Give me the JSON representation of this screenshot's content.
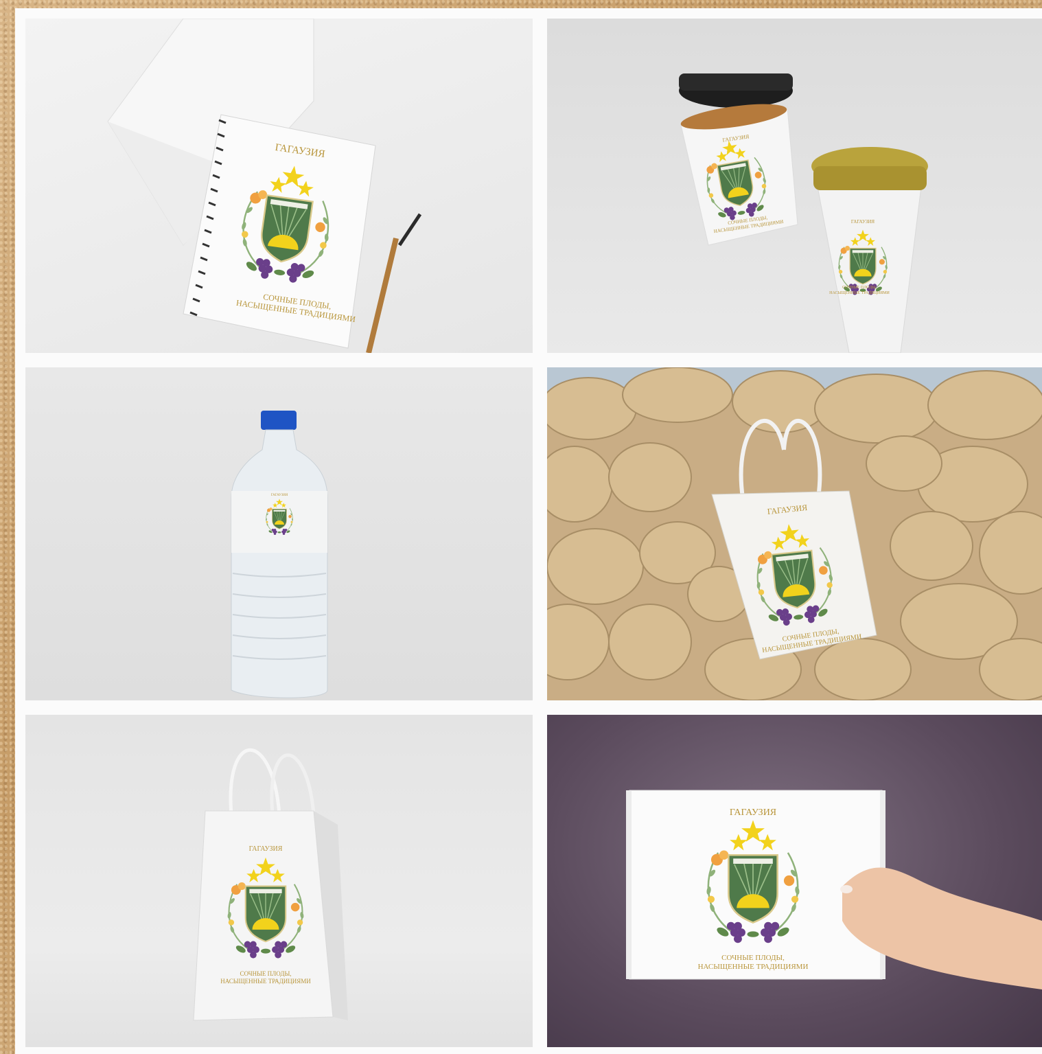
{
  "brand": {
    "region_name": "ГАГАУЗИЯ",
    "slogan_line1": "СОЧНЫЕ ПЛОДЫ,",
    "slogan_line2": "НАСЫЩЕННЫЕ ТРАДИЦИЯМИ"
  },
  "panels": [
    {
      "item": "notebook"
    },
    {
      "item": "coffee-cups"
    },
    {
      "item": "water-bottle"
    },
    {
      "item": "tote-bag"
    },
    {
      "item": "paper-bag"
    },
    {
      "item": "gift-box"
    }
  ],
  "colors": {
    "gold": "#b8953a",
    "star": "#f2d21c",
    "shield_green": "#4f7a4a",
    "grape": "#6a3f8a",
    "peach": "#f0a040",
    "leaf": "#7fa66a"
  }
}
